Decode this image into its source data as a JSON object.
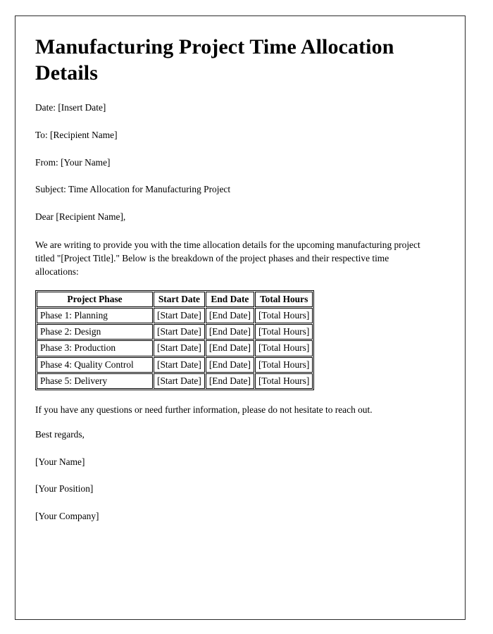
{
  "document": {
    "title": "Manufacturing Project Time Allocation Details",
    "header_lines": [
      "Date: [Insert Date]",
      "To: [Recipient Name]",
      "From: [Your Name]",
      "Subject: Time Allocation for Manufacturing Project",
      "Dear [Recipient Name],"
    ],
    "intro_paragraph": "We are writing to provide you with the time allocation details for the upcoming manufacturing project titled \"[Project Title].\" Below is the breakdown of the project phases and their respective time allocations:",
    "closing_paragraph": "If you have any questions or need further information, please do not hesitate to reach out.",
    "signoff_lines": [
      "Best regards,",
      "[Your Name]",
      "[Your Position]",
      "[Your Company]"
    ]
  },
  "table": {
    "columns": [
      "Project Phase",
      "Start Date",
      "End Date",
      "Total Hours"
    ],
    "rows": [
      {
        "phase": "Phase 1: Planning",
        "start": "[Start Date]",
        "end": "[End Date]",
        "hours": "[Total Hours]"
      },
      {
        "phase": "Phase 2: Design",
        "start": "[Start Date]",
        "end": "[End Date]",
        "hours": "[Total Hours]"
      },
      {
        "phase": "Phase 3: Production",
        "start": "[Start Date]",
        "end": "[End Date]",
        "hours": "[Total Hours]"
      },
      {
        "phase": "Phase 4: Quality Control",
        "start": "[Start Date]",
        "end": "[End Date]",
        "hours": "[Total Hours]"
      },
      {
        "phase": "Phase 5: Delivery",
        "start": "[Start Date]",
        "end": "[End Date]",
        "hours": "[Total Hours]"
      }
    ]
  },
  "style": {
    "page_border_color": "#2b2b2b",
    "text_color": "#000000",
    "background_color": "#ffffff"
  }
}
